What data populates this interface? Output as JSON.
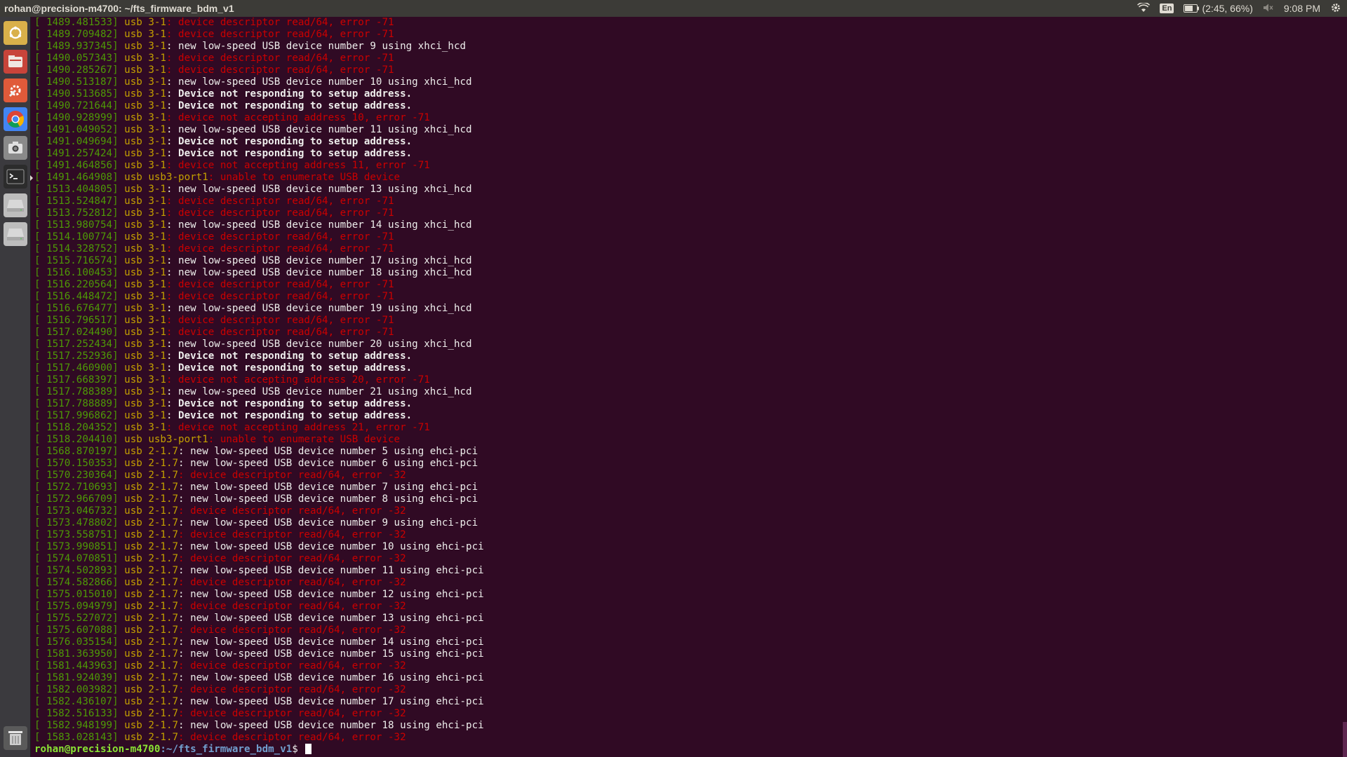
{
  "window": {
    "title": "rohan@precision-m4700: ~/fts_firmware_bdm_v1"
  },
  "status": {
    "keyboard": "En",
    "battery": "(2:45, 66%)",
    "time": "9:08 PM"
  },
  "launcher": {
    "items": [
      {
        "name": "dash-home-icon",
        "color": "#d9b04a"
      },
      {
        "name": "files-icon",
        "color": "#c8443a"
      },
      {
        "name": "settings-tool-icon",
        "color": "#e05a3a"
      },
      {
        "name": "chrome-icon",
        "color": "#4285f4"
      },
      {
        "name": "camera-icon",
        "color": "#8a8a8a"
      },
      {
        "name": "terminal-icon",
        "color": "#2c2c2c"
      },
      {
        "name": "drive-icon",
        "color": "#bdbdbd"
      },
      {
        "name": "drive2-icon",
        "color": "#bdbdbd"
      }
    ],
    "trash": "trash-icon"
  },
  "terminal": {
    "lines": [
      {
        "ts": "1489.481533",
        "dev": "usb 3-1",
        "msg": "device descriptor read/64, error -71",
        "type": "err"
      },
      {
        "ts": "1489.709482",
        "dev": "usb 3-1",
        "msg": "device descriptor read/64, error -71",
        "type": "err"
      },
      {
        "ts": "1489.937345",
        "dev": "usb 3-1",
        "msg": "new low-speed USB device number 9 using xhci_hcd",
        "type": "normal"
      },
      {
        "ts": "1490.057343",
        "dev": "usb 3-1",
        "msg": "device descriptor read/64, error -71",
        "type": "err"
      },
      {
        "ts": "1490.285267",
        "dev": "usb 3-1",
        "msg": "device descriptor read/64, error -71",
        "type": "err"
      },
      {
        "ts": "1490.513187",
        "dev": "usb 3-1",
        "msg": "new low-speed USB device number 10 using xhci_hcd",
        "type": "normal"
      },
      {
        "ts": "1490.513685",
        "dev": "usb 3-1",
        "msg": "Device not responding to setup address.",
        "type": "bold"
      },
      {
        "ts": "1490.721644",
        "dev": "usb 3-1",
        "msg": "Device not responding to setup address.",
        "type": "bold"
      },
      {
        "ts": "1490.928999",
        "dev": "usb 3-1",
        "msg": "device not accepting address 10, error -71",
        "type": "err"
      },
      {
        "ts": "1491.049052",
        "dev": "usb 3-1",
        "msg": "new low-speed USB device number 11 using xhci_hcd",
        "type": "normal"
      },
      {
        "ts": "1491.049694",
        "dev": "usb 3-1",
        "msg": "Device not responding to setup address.",
        "type": "bold"
      },
      {
        "ts": "1491.257424",
        "dev": "usb 3-1",
        "msg": "Device not responding to setup address.",
        "type": "bold"
      },
      {
        "ts": "1491.464856",
        "dev": "usb 3-1",
        "msg": "device not accepting address 11, error -71",
        "type": "err"
      },
      {
        "ts": "1491.464908",
        "dev": "usb usb3-port1",
        "msg": "unable to enumerate USB device",
        "type": "err"
      },
      {
        "ts": "1513.404805",
        "dev": "usb 3-1",
        "msg": "new low-speed USB device number 13 using xhci_hcd",
        "type": "normal"
      },
      {
        "ts": "1513.524847",
        "dev": "usb 3-1",
        "msg": "device descriptor read/64, error -71",
        "type": "err"
      },
      {
        "ts": "1513.752812",
        "dev": "usb 3-1",
        "msg": "device descriptor read/64, error -71",
        "type": "err"
      },
      {
        "ts": "1513.980754",
        "dev": "usb 3-1",
        "msg": "new low-speed USB device number 14 using xhci_hcd",
        "type": "normal"
      },
      {
        "ts": "1514.100774",
        "dev": "usb 3-1",
        "msg": "device descriptor read/64, error -71",
        "type": "err"
      },
      {
        "ts": "1514.328752",
        "dev": "usb 3-1",
        "msg": "device descriptor read/64, error -71",
        "type": "err"
      },
      {
        "ts": "1515.716574",
        "dev": "usb 3-1",
        "msg": "new low-speed USB device number 17 using xhci_hcd",
        "type": "normal"
      },
      {
        "ts": "1516.100453",
        "dev": "usb 3-1",
        "msg": "new low-speed USB device number 18 using xhci_hcd",
        "type": "normal"
      },
      {
        "ts": "1516.220564",
        "dev": "usb 3-1",
        "msg": "device descriptor read/64, error -71",
        "type": "err"
      },
      {
        "ts": "1516.448472",
        "dev": "usb 3-1",
        "msg": "device descriptor read/64, error -71",
        "type": "err"
      },
      {
        "ts": "1516.676477",
        "dev": "usb 3-1",
        "msg": "new low-speed USB device number 19 using xhci_hcd",
        "type": "normal"
      },
      {
        "ts": "1516.796517",
        "dev": "usb 3-1",
        "msg": "device descriptor read/64, error -71",
        "type": "err"
      },
      {
        "ts": "1517.024490",
        "dev": "usb 3-1",
        "msg": "device descriptor read/64, error -71",
        "type": "err"
      },
      {
        "ts": "1517.252434",
        "dev": "usb 3-1",
        "msg": "new low-speed USB device number 20 using xhci_hcd",
        "type": "normal"
      },
      {
        "ts": "1517.252936",
        "dev": "usb 3-1",
        "msg": "Device not responding to setup address.",
        "type": "bold"
      },
      {
        "ts": "1517.460900",
        "dev": "usb 3-1",
        "msg": "Device not responding to setup address.",
        "type": "bold"
      },
      {
        "ts": "1517.668397",
        "dev": "usb 3-1",
        "msg": "device not accepting address 20, error -71",
        "type": "err"
      },
      {
        "ts": "1517.788389",
        "dev": "usb 3-1",
        "msg": "new low-speed USB device number 21 using xhci_hcd",
        "type": "normal"
      },
      {
        "ts": "1517.788889",
        "dev": "usb 3-1",
        "msg": "Device not responding to setup address.",
        "type": "bold"
      },
      {
        "ts": "1517.996862",
        "dev": "usb 3-1",
        "msg": "Device not responding to setup address.",
        "type": "bold"
      },
      {
        "ts": "1518.204352",
        "dev": "usb 3-1",
        "msg": "device not accepting address 21, error -71",
        "type": "err"
      },
      {
        "ts": "1518.204410",
        "dev": "usb usb3-port1",
        "msg": "unable to enumerate USB device",
        "type": "err"
      },
      {
        "ts": "1568.870197",
        "dev": "usb 2-1.7",
        "msg": "new low-speed USB device number 5 using ehci-pci",
        "type": "normal"
      },
      {
        "ts": "1570.150353",
        "dev": "usb 2-1.7",
        "msg": "new low-speed USB device number 6 using ehci-pci",
        "type": "normal"
      },
      {
        "ts": "1570.230364",
        "dev": "usb 2-1.7",
        "msg": "device descriptor read/64, error -32",
        "type": "err"
      },
      {
        "ts": "1572.710693",
        "dev": "usb 2-1.7",
        "msg": "new low-speed USB device number 7 using ehci-pci",
        "type": "normal"
      },
      {
        "ts": "1572.966709",
        "dev": "usb 2-1.7",
        "msg": "new low-speed USB device number 8 using ehci-pci",
        "type": "normal"
      },
      {
        "ts": "1573.046732",
        "dev": "usb 2-1.7",
        "msg": "device descriptor read/64, error -32",
        "type": "err"
      },
      {
        "ts": "1573.478802",
        "dev": "usb 2-1.7",
        "msg": "new low-speed USB device number 9 using ehci-pci",
        "type": "normal"
      },
      {
        "ts": "1573.558751",
        "dev": "usb 2-1.7",
        "msg": "device descriptor read/64, error -32",
        "type": "err"
      },
      {
        "ts": "1573.990851",
        "dev": "usb 2-1.7",
        "msg": "new low-speed USB device number 10 using ehci-pci",
        "type": "normal"
      },
      {
        "ts": "1574.070851",
        "dev": "usb 2-1.7",
        "msg": "device descriptor read/64, error -32",
        "type": "err"
      },
      {
        "ts": "1574.502893",
        "dev": "usb 2-1.7",
        "msg": "new low-speed USB device number 11 using ehci-pci",
        "type": "normal"
      },
      {
        "ts": "1574.582866",
        "dev": "usb 2-1.7",
        "msg": "device descriptor read/64, error -32",
        "type": "err"
      },
      {
        "ts": "1575.015010",
        "dev": "usb 2-1.7",
        "msg": "new low-speed USB device number 12 using ehci-pci",
        "type": "normal"
      },
      {
        "ts": "1575.094979",
        "dev": "usb 2-1.7",
        "msg": "device descriptor read/64, error -32",
        "type": "err"
      },
      {
        "ts": "1575.527072",
        "dev": "usb 2-1.7",
        "msg": "new low-speed USB device number 13 using ehci-pci",
        "type": "normal"
      },
      {
        "ts": "1575.607088",
        "dev": "usb 2-1.7",
        "msg": "device descriptor read/64, error -32",
        "type": "err"
      },
      {
        "ts": "1576.035154",
        "dev": "usb 2-1.7",
        "msg": "new low-speed USB device number 14 using ehci-pci",
        "type": "normal"
      },
      {
        "ts": "1581.363950",
        "dev": "usb 2-1.7",
        "msg": "new low-speed USB device number 15 using ehci-pci",
        "type": "normal"
      },
      {
        "ts": "1581.443963",
        "dev": "usb 2-1.7",
        "msg": "device descriptor read/64, error -32",
        "type": "err"
      },
      {
        "ts": "1581.924039",
        "dev": "usb 2-1.7",
        "msg": "new low-speed USB device number 16 using ehci-pci",
        "type": "normal"
      },
      {
        "ts": "1582.003982",
        "dev": "usb 2-1.7",
        "msg": "device descriptor read/64, error -32",
        "type": "err"
      },
      {
        "ts": "1582.436107",
        "dev": "usb 2-1.7",
        "msg": "new low-speed USB device number 17 using ehci-pci",
        "type": "normal"
      },
      {
        "ts": "1582.516133",
        "dev": "usb 2-1.7",
        "msg": "device descriptor read/64, error -32",
        "type": "err"
      },
      {
        "ts": "1582.948199",
        "dev": "usb 2-1.7",
        "msg": "new low-speed USB device number 18 using ehci-pci",
        "type": "normal"
      },
      {
        "ts": "1583.028143",
        "dev": "usb 2-1.7",
        "msg": "device descriptor read/64, error -32",
        "type": "err"
      }
    ],
    "prompt": {
      "user_host": "rohan@precision-m4700",
      "path": ":~/fts_firmware_bdm_v1",
      "symbol": "$ "
    }
  }
}
